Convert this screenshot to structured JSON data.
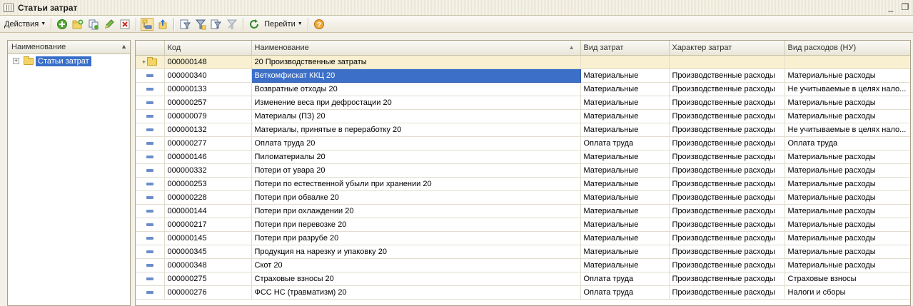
{
  "window": {
    "title": "Статьи затрат",
    "minimize": "_",
    "restore": "❐"
  },
  "toolbar": {
    "actions_label": "Действия",
    "goto_label": "Перейти",
    "icons": [
      "add-icon",
      "add-group-icon",
      "copy-icon",
      "edit-icon",
      "delete-icon",
      "hierarchy-icon",
      "level-up-icon",
      "filter-icon",
      "filter-value-icon",
      "filter-dropdown-icon",
      "clear-filter-icon",
      "refresh-icon",
      "help-icon"
    ]
  },
  "tree": {
    "header": "Наименование",
    "sort_marker": "▲",
    "root_label": "Статьи затрат",
    "expander": "+"
  },
  "grid": {
    "columns": [
      "Код",
      "Наименование",
      "Вид затрат",
      "Характер затрат",
      "Вид расходов (НУ)"
    ],
    "sort_marker": "▲",
    "group": {
      "code": "000000148",
      "name": "20 Производственные затраты",
      "marker": "+"
    },
    "rows": [
      {
        "code": "000000340",
        "name": "Веткомфискат ККЦ 20",
        "kind": "Материальные",
        "nature": "Производственные расходы",
        "tax": "Материальные расходы"
      },
      {
        "code": "000000133",
        "name": "Возвратные отходы 20",
        "kind": "Материальные",
        "nature": "Производственные расходы",
        "tax": "Не учитываемые в целях нало..."
      },
      {
        "code": "000000257",
        "name": "Изменение веса при дефростации  20",
        "kind": "Материальные",
        "nature": "Производственные расходы",
        "tax": "Материальные расходы"
      },
      {
        "code": "000000079",
        "name": "Материалы  (ПЗ) 20",
        "kind": "Материальные",
        "nature": "Производственные расходы",
        "tax": "Материальные расходы"
      },
      {
        "code": "000000132",
        "name": "Материалы, принятые в переработку 20",
        "kind": "Материальные",
        "nature": "Производственные расходы",
        "tax": "Не учитываемые в целях нало..."
      },
      {
        "code": "000000277",
        "name": "Оплата труда 20",
        "kind": "Оплата труда",
        "nature": "Производственные расходы",
        "tax": "Оплата труда"
      },
      {
        "code": "000000146",
        "name": "Пиломатериалы 20",
        "kind": "Материальные",
        "nature": "Производственные расходы",
        "tax": "Материальные расходы"
      },
      {
        "code": "000000332",
        "name": "Потери от увара 20",
        "kind": "Материальные",
        "nature": "Производственные расходы",
        "tax": "Материальные расходы"
      },
      {
        "code": "000000253",
        "name": "Потери по естественной убыли при хранении  20",
        "kind": "Материальные",
        "nature": "Производственные расходы",
        "tax": "Материальные расходы"
      },
      {
        "code": "000000228",
        "name": "Потери при обвалке 20",
        "kind": "Материальные",
        "nature": "Производственные расходы",
        "tax": "Материальные расходы"
      },
      {
        "code": "000000144",
        "name": "Потери при охлаждении 20",
        "kind": "Материальные",
        "nature": "Производственные расходы",
        "tax": "Материальные расходы"
      },
      {
        "code": "000000217",
        "name": "Потери при перевозке 20",
        "kind": "Материальные",
        "nature": "Производственные расходы",
        "tax": "Материальные расходы"
      },
      {
        "code": "000000145",
        "name": "Потери при разрубе 20",
        "kind": "Материальные",
        "nature": "Производственные расходы",
        "tax": "Материальные расходы"
      },
      {
        "code": "000000345",
        "name": "Продукция на нарезку  и упаковку 20",
        "kind": "Материальные",
        "nature": "Производственные расходы",
        "tax": "Материальные расходы"
      },
      {
        "code": "000000348",
        "name": "Скот 20",
        "kind": "Материальные",
        "nature": "Производственные расходы",
        "tax": "Материальные расходы"
      },
      {
        "code": "000000275",
        "name": "Страховые взносы 20",
        "kind": "Оплата труда",
        "nature": "Производственные расходы",
        "tax": "Страховые взносы"
      },
      {
        "code": "000000276",
        "name": "ФСС НС (травматизм) 20",
        "kind": "Оплата труда",
        "nature": "Производственные расходы",
        "tax": "Налоги и сборы"
      }
    ]
  },
  "colors": {
    "selection": "#3b6fc8",
    "group_row": "#f8f0d0",
    "item_marker": "#6b8ec9"
  }
}
